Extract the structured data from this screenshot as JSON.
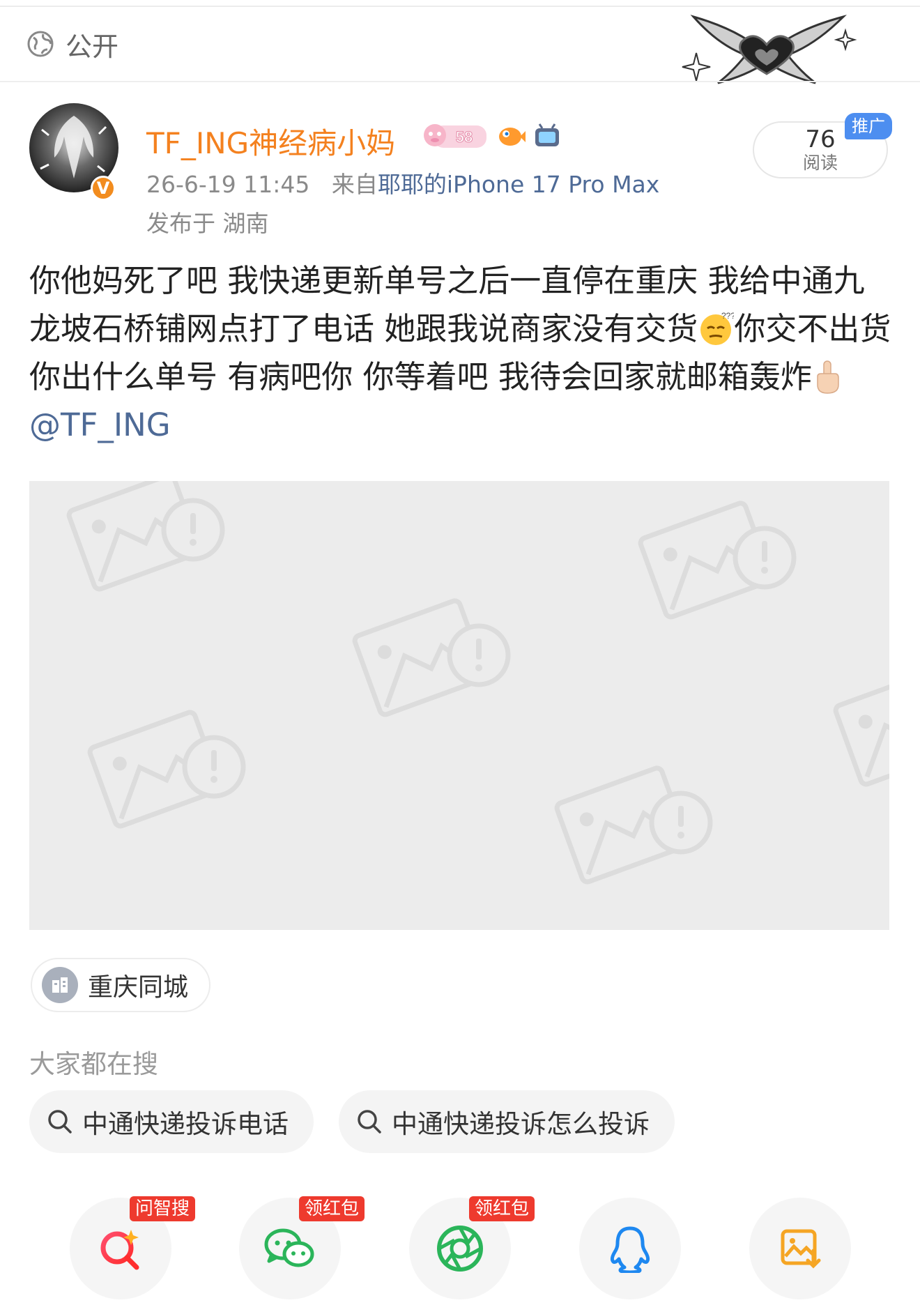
{
  "header": {
    "visibility_label": "公开"
  },
  "post": {
    "username": "TF_ING神经病小妈",
    "vip_badge": "58",
    "verified_mark": "V",
    "time": "26-6-19 11:45",
    "source_prefix": "来自",
    "source_device": "耶耶的iPhone 17 Pro Max",
    "location": "发布于 湖南",
    "reads_count": "76",
    "reads_label": "阅读",
    "promo_badge": "推广",
    "text_part1": "你他妈死了吧 我快递更新单号之后一直停在重庆 我给中通九龙坡石桥铺网点打了电话 她跟我说商家没有交货",
    "text_part2": "你交不出货你出什么单号 有病吧你 你等着吧 我待会回家就邮箱轰炸",
    "mention": "@TF_ING",
    "emoji_confused": "confused-face-emoji",
    "emoji_finger": "middle-finger-emoji"
  },
  "location_tag": {
    "label": "重庆同城"
  },
  "search": {
    "heading": "大家都在搜",
    "chips": [
      "中通快递投诉电话",
      "中通快递投诉怎么投诉"
    ]
  },
  "share": {
    "items": [
      {
        "icon": "ai-search-icon",
        "badge": "问智搜"
      },
      {
        "icon": "wechat-icon",
        "badge": "领红包"
      },
      {
        "icon": "moments-icon",
        "badge": "领红包"
      },
      {
        "icon": "qq-icon",
        "badge": ""
      },
      {
        "icon": "save-image-icon",
        "badge": ""
      }
    ]
  },
  "colors": {
    "username": "#f4811f",
    "link": "#4e6a96",
    "promo": "#4d8ef0",
    "badge_red": "#ee3a2e"
  }
}
